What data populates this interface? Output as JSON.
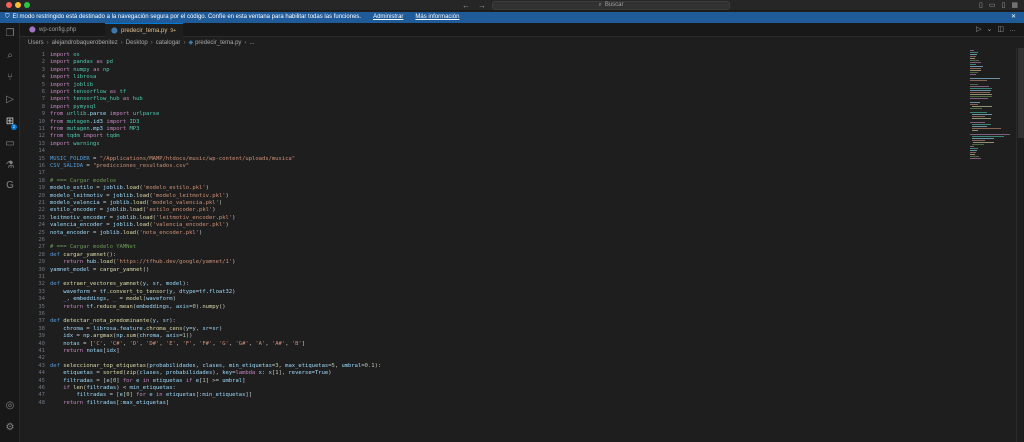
{
  "titlebar": {
    "search_label": "Buscar"
  },
  "banner": {
    "message": "El modo restringido está destinado a la navegación segura por el código. Confíe en esta ventana para habilitar todas las funciones.",
    "link_manage": "Administrar",
    "link_more": "Más información"
  },
  "tabs": [
    {
      "label": "wp-config.php",
      "active": false
    },
    {
      "label": "predecir_tema.py",
      "active": true,
      "status": "9+"
    }
  ],
  "breadcrumb": [
    "Users",
    "alejandrobaquerobenitez",
    "Desktop",
    "catalogar",
    "predecir_tema.py",
    "..."
  ],
  "code_lines": [
    "import os",
    "import pandas as pd",
    "import numpy as np",
    "import librosa",
    "import joblib",
    "import tensorflow as tf",
    "import tensorflow_hub as hub",
    "import pymysql",
    "from urllib.parse import urlparse",
    "from mutagen.id3 import ID3",
    "from mutagen.mp3 import MP3",
    "from tqdm import tqdm",
    "import warnings",
    "",
    "MUSIC_FOLDER = \"/Applications/MAMP/htdocs/music/wp-content/uploads/musica\"",
    "CSV_SALIDA = \"predicciones_resultados.csv\"",
    "",
    "# === Cargar modelos",
    "modelo_estilo = joblib.load('modelo_estilo.pkl')",
    "modelo_leitmotiv = joblib.load('modelo_leitmotiv.pkl')",
    "modelo_valencia = joblib.load('modelo_valencia.pkl')",
    "estilo_encoder = joblib.load('estilo_encoder.pkl')",
    "leitmotiv_encoder = joblib.load('leitmotiv_encoder.pkl')",
    "valencia_encoder = joblib.load('valencia_encoder.pkl')",
    "nota_encoder = joblib.load('nota_encoder.pkl')",
    "",
    "# === Cargar modelo YAMNet",
    "def cargar_yamnet():",
    "    return hub.load('https://tfhub.dev/google/yamnet/1')",
    "yamnet_model = cargar_yamnet()",
    "",
    "def extraer_vectores_yamnet(y, sr, model):",
    "    waveform = tf.convert_to_tensor(y, dtype=tf.float32)",
    "    _, embeddings, _ = model(waveform)",
    "    return tf.reduce_mean(embeddings, axis=0).numpy()",
    "",
    "def detectar_nota_predominante(y, sr):",
    "    chroma = librosa.feature.chroma_cens(y=y, sr=sr)",
    "    idx = np.argmax(np.sum(chroma, axis=1))",
    "    notas = ['C', 'C#', 'D', 'D#', 'E', 'F', 'F#', 'G', 'G#', 'A', 'A#', 'B']",
    "    return notas[idx]",
    "",
    "def seleccionar_top_etiquetas(probabilidades, clases, min_etiquetas=3, max_etiquetas=5, umbral=0.1):",
    "    etiquetas = sorted(zip(clases, probabilidades), key=lambda x: x[1], reverse=True)",
    "    filtradas = [e[0] for e in etiquetas if e[1] >= umbral]",
    "    if len(filtradas) < min_etiquetas:",
    "        filtradas = [e[0] for e in etiquetas[:min_etiquetas]]",
    "    return filtradas[:max_etiquetas]"
  ],
  "colors": {
    "keyword": "#c586c0",
    "module": "#4ec9b0",
    "string": "#ce9178",
    "comment": "#6a9955",
    "function": "#dcdcaa",
    "variable": "#9cdcfe",
    "number": "#b5cea8",
    "def": "#569cd6",
    "banner": "#1f5a99"
  },
  "icons": [
    "explorer-icon",
    "search-icon",
    "source-control-icon",
    "run-debug-icon",
    "extensions-icon",
    "remote-icon",
    "testing-icon",
    "git-graph-icon",
    "account-icon",
    "settings-gear-icon"
  ]
}
